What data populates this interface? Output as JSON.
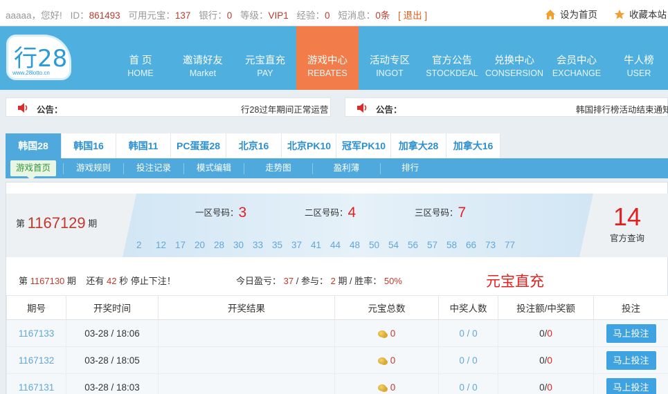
{
  "topbar": {
    "username": "aaaaa",
    "greeting": "，您好!",
    "id_label": "ID：",
    "id_value": "861493",
    "balance_label": "可用元宝：",
    "balance_value": "137",
    "bank_label": "银行：",
    "bank_value": "0",
    "level_label": "等级：",
    "level_value": "VIP1",
    "exp_label": "经验：",
    "exp_value": "0",
    "msg_label": "短消息：",
    "msg_value": "0条",
    "logout": "[ 退出 ]",
    "set_home": "设为首页",
    "bookmark": "收藏本站"
  },
  "logo": {
    "text": "行28",
    "url": "www.28lotto.cn"
  },
  "nav": [
    {
      "zh": "首 页",
      "en": "HOME"
    },
    {
      "zh": "邀请好友",
      "en": "Market"
    },
    {
      "zh": "元宝直充",
      "en": "PAY"
    },
    {
      "zh": "游戏中心",
      "en": "REBATES",
      "active": true
    },
    {
      "zh": "活动专区",
      "en": "INGOT"
    },
    {
      "zh": "官方公告",
      "en": "STOCKDEAL"
    },
    {
      "zh": "兑换中心",
      "en": "CONSERSION"
    },
    {
      "zh": "会员中心",
      "en": "EXCHANGE"
    },
    {
      "zh": "牛人榜",
      "en": "USER"
    }
  ],
  "notices": [
    {
      "label": "公告：",
      "text": "行28过年期间正常运营"
    },
    {
      "label": "公告：",
      "text": "韩国排行榜活动结束通知"
    }
  ],
  "game_tabs": [
    "韩国28",
    "韩国16",
    "韩国11",
    "PC蛋蛋28",
    "北京16",
    "北京PK10",
    "冠军PK10",
    "加拿大28",
    "加拿大16"
  ],
  "sub_tabs": [
    "游戏首页",
    "游戏规则",
    "投注记录",
    "模式编辑",
    "走势图",
    "盈利薄",
    "排行"
  ],
  "current_draw": {
    "prefix": "第",
    "issue": "1167129",
    "suffix": "期",
    "zone1_label": "一区号码：",
    "zone1": "3",
    "zone2_label": "二区号码：",
    "zone2": "4",
    "zone3_label": "三区号码：",
    "zone3": "7",
    "sums": [
      "2",
      "12",
      "17",
      "20",
      "28",
      "30",
      "33",
      "35",
      "37",
      "41",
      "44",
      "48",
      "50",
      "54",
      "56",
      "57",
      "58",
      "66",
      "73",
      "77"
    ],
    "result": "14",
    "result_label": "官方查询"
  },
  "next_draw": {
    "prefix": "第",
    "issue": "1167130",
    "suffix": "期",
    "remain_prefix": "还有",
    "seconds": "42",
    "remain_suffix": "秒 停止下注！",
    "today_label": "今日盈亏：",
    "today_value": "37",
    "join_label": " / 参与：",
    "join_value": "2",
    "rate_label": "期 / 胜率：",
    "rate_value": "50%",
    "recharge": "元宝直充"
  },
  "table": {
    "headers": [
      "期号",
      "开奖时间",
      "开奖结果",
      "元宝总数",
      "中奖人数",
      "投注额/中奖额",
      "投注"
    ],
    "rows": [
      {
        "issue": "1167133",
        "time": "03-28 / 18:06",
        "result": "",
        "gold": "0",
        "winners": "0 / 0",
        "bet_a": "0",
        "bet_b": "0",
        "action": "马上投注"
      },
      {
        "issue": "1167132",
        "time": "03-28 / 18:05",
        "result": "",
        "gold": "0",
        "winners": "0 / 0",
        "bet_a": "0",
        "bet_b": "0",
        "action": "马上投注"
      },
      {
        "issue": "1167131",
        "time": "03-28 / 18:03",
        "result": "",
        "gold": "0",
        "winners": "0 / 0",
        "bet_a": "0",
        "bet_b": "0",
        "action": "马上投注"
      }
    ]
  },
  "colors": {
    "header": "#4fb0e0",
    "active_nav": "#f27c4a",
    "accent_red": "#e32020",
    "link_blue": "#5fa8d8"
  }
}
